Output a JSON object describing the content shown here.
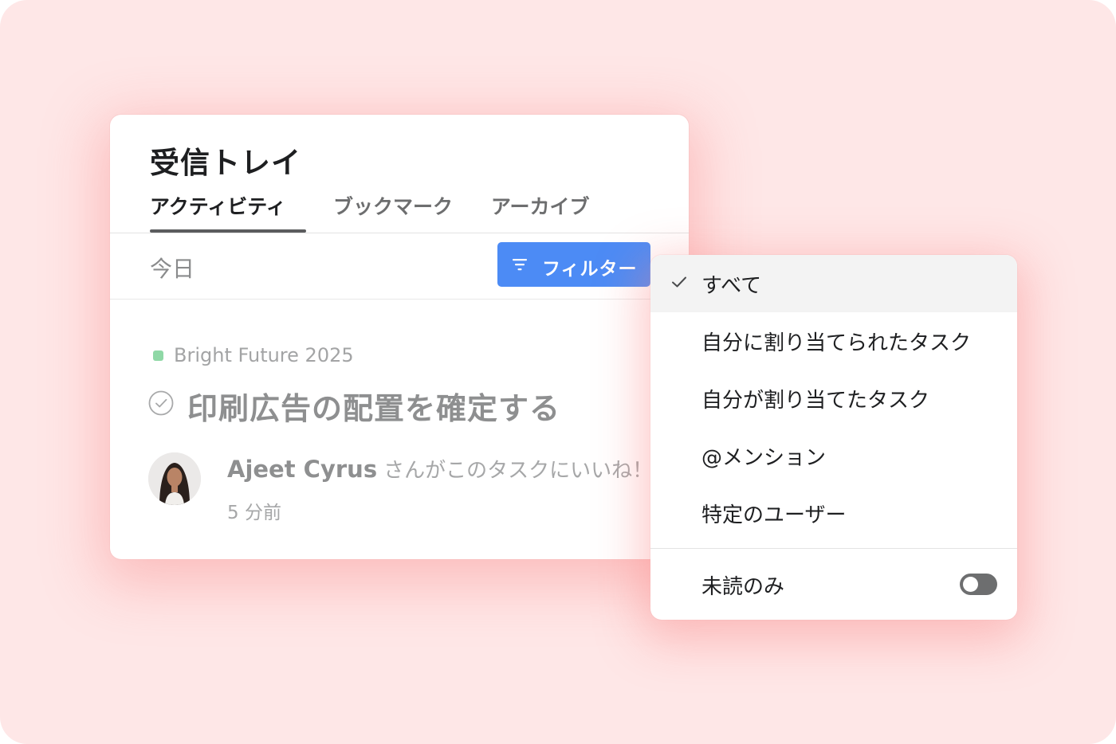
{
  "inbox": {
    "title": "受信トレイ",
    "tabs": [
      {
        "label": "アクティビティ",
        "active": true
      },
      {
        "label": "ブックマーク",
        "active": false
      },
      {
        "label": "アーカイブ",
        "active": false
      }
    ],
    "section_label": "今日",
    "filter_button": {
      "label": "フィルター",
      "icon": "filter-icon",
      "color": "#4c8bf5"
    },
    "notification": {
      "project": {
        "name": "Bright Future 2025",
        "color": "#8fd8a6"
      },
      "task_title": "印刷広告の配置を確定する",
      "user": "Ajeet Cyrus",
      "activity_text": "さんがこのタスクにいいね！",
      "timestamp": "5 分前"
    }
  },
  "filter_menu": {
    "items": [
      {
        "label": "すべて",
        "selected": true
      },
      {
        "label": "自分に割り当てられたタスク",
        "selected": false
      },
      {
        "label": "自分が割り当てたタスク",
        "selected": false
      },
      {
        "label": "@メンション",
        "selected": false
      },
      {
        "label": "特定のユーザー",
        "selected": false
      }
    ],
    "unread_only": {
      "label": "未読のみ",
      "enabled": false
    }
  }
}
